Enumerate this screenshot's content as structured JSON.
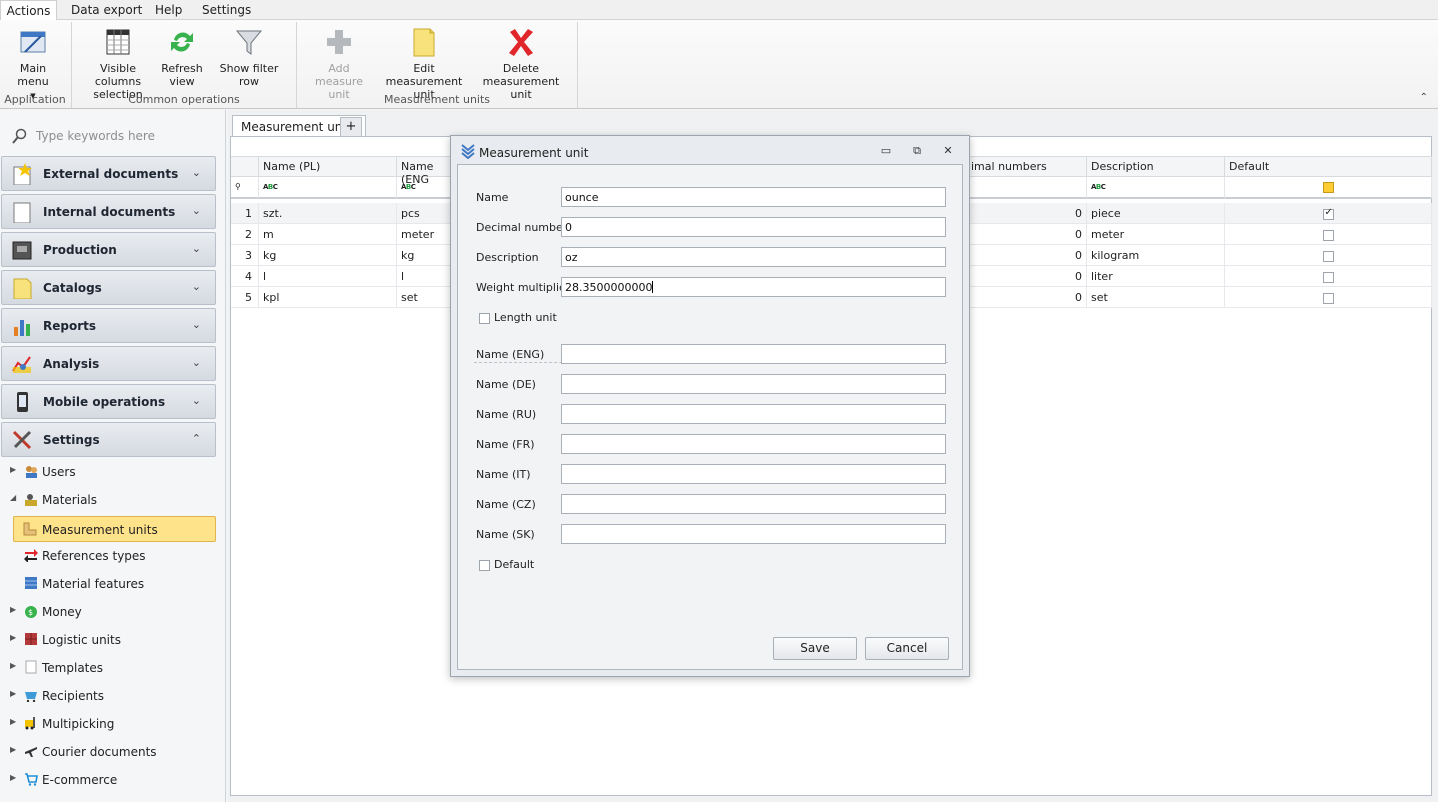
{
  "menu": [
    "Actions",
    "Data export",
    "Help",
    "Settings"
  ],
  "ribbon": {
    "application": {
      "label": "Application",
      "main_menu": "Main menu"
    },
    "common": {
      "label": "Common operations",
      "visible_columns": [
        "Visible columns",
        "selection"
      ],
      "refresh": [
        "Refresh",
        "view"
      ],
      "show_filter": "Show filter row"
    },
    "units": {
      "label": "Measurement units",
      "add": [
        "Add measure",
        "unit"
      ],
      "edit": [
        "Edit measurement",
        "unit"
      ],
      "delete": [
        "Delete",
        "measurement unit"
      ]
    }
  },
  "sidebar": {
    "search_placeholder": "Type keywords here",
    "groups": [
      "External documents",
      "Internal documents",
      "Production",
      "Catalogs",
      "Reports",
      "Analysis",
      "Mobile operations",
      "Settings"
    ],
    "tree": [
      "Users",
      "Materials",
      "Measurement units",
      "References types",
      "Material features",
      "Money",
      "Logistic units",
      "Templates",
      "Recipients",
      "Multipicking",
      "Courier documents",
      "E-commerce"
    ]
  },
  "main": {
    "tab": "Measurement units",
    "tab_add": "+",
    "columns": [
      "Name (PL)",
      "Name (ENG",
      "imal numbers",
      "Description",
      "Default"
    ],
    "rows": [
      {
        "n": "1",
        "pl": "szt.",
        "eng": "pcs",
        "dec": "0",
        "desc": "piece",
        "def": true
      },
      {
        "n": "2",
        "pl": "m",
        "eng": "meter",
        "dec": "0",
        "desc": "meter",
        "def": false
      },
      {
        "n": "3",
        "pl": "kg",
        "eng": "kg",
        "dec": "0",
        "desc": "kilogram",
        "def": false
      },
      {
        "n": "4",
        "pl": "l",
        "eng": "l",
        "dec": "0",
        "desc": "liter",
        "def": false
      },
      {
        "n": "5",
        "pl": "kpl",
        "eng": "set",
        "dec": "0",
        "desc": "set",
        "def": false
      }
    ]
  },
  "dialog": {
    "title": "Measurement unit",
    "fields": {
      "name": {
        "label": "Name",
        "value": "ounce"
      },
      "decimal": {
        "label": "Decimal numbers",
        "value": "0"
      },
      "description": {
        "label": "Description",
        "value": "oz"
      },
      "weight": {
        "label": "Weight multiplier",
        "value": "28.3500000000"
      }
    },
    "length_unit": "Length unit",
    "names": [
      {
        "label": "Name (ENG)",
        "value": ""
      },
      {
        "label": "Name (DE)",
        "value": ""
      },
      {
        "label": "Name (RU)",
        "value": ""
      },
      {
        "label": "Name (FR)",
        "value": ""
      },
      {
        "label": "Name (IT)",
        "value": ""
      },
      {
        "label": "Name (CZ)",
        "value": ""
      },
      {
        "label": "Name (SK)",
        "value": ""
      }
    ],
    "default": "Default",
    "save": "Save",
    "cancel": "Cancel"
  }
}
